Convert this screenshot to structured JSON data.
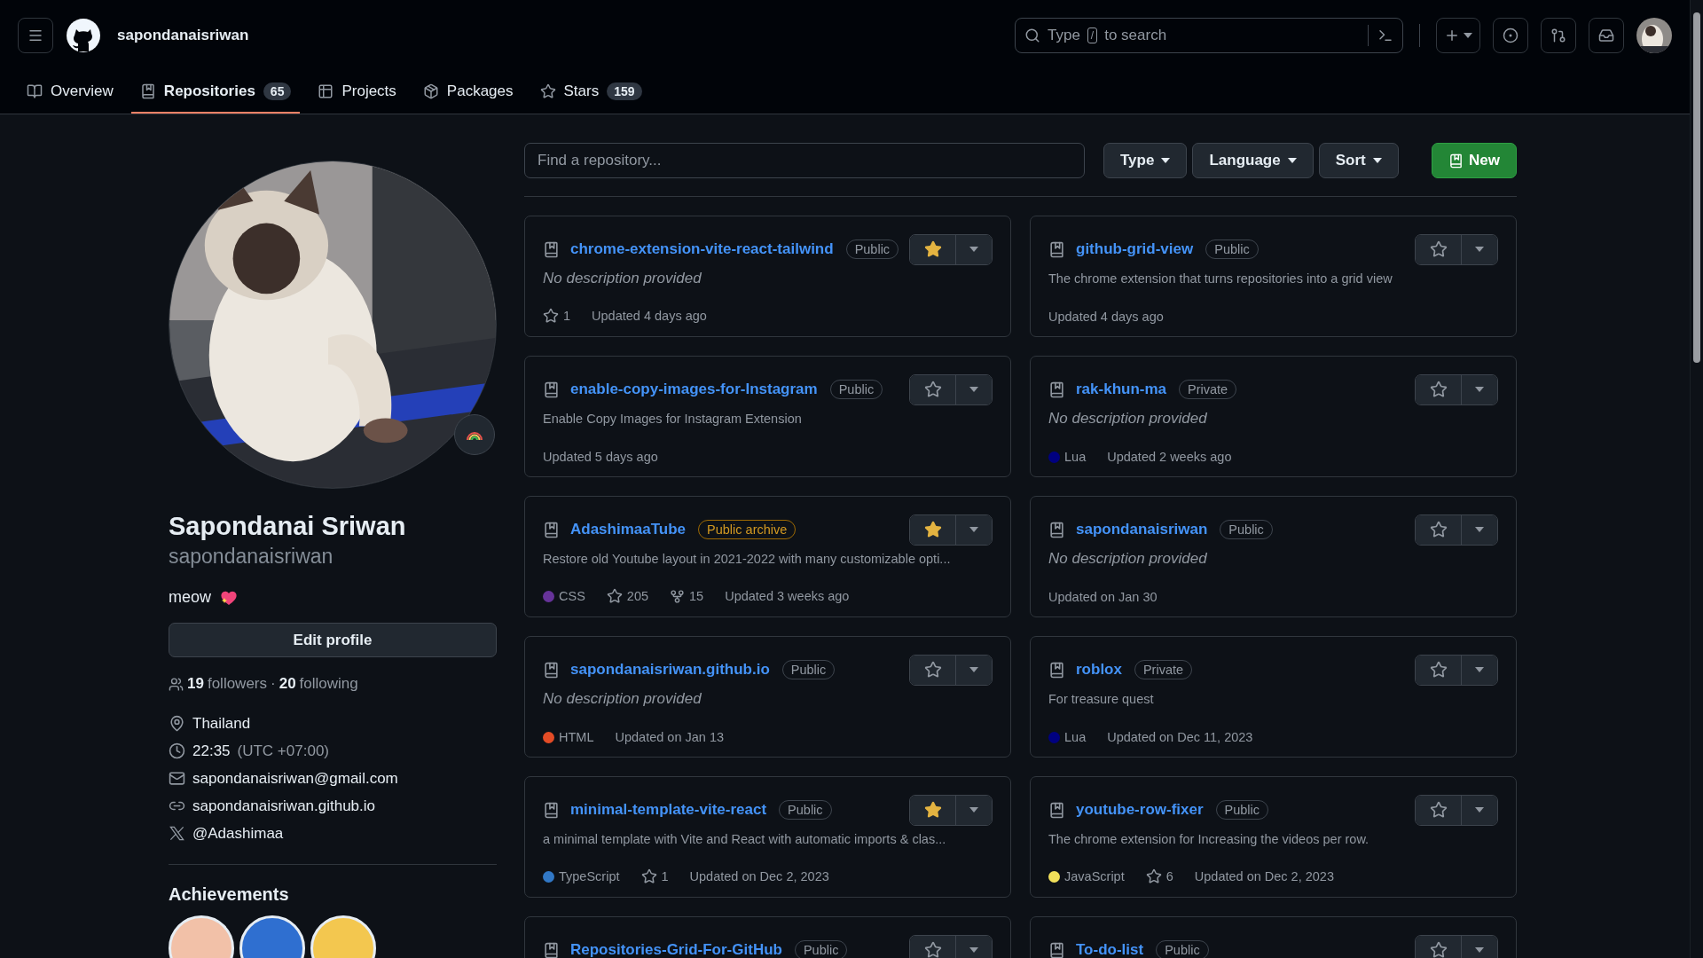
{
  "header": {
    "username": "sapondanaisriwan",
    "search": {
      "prefix": "Type",
      "key": "/",
      "suffix": "to search"
    }
  },
  "tabs": [
    {
      "label": "Overview",
      "kind": "book",
      "selected": false
    },
    {
      "label": "Repositories",
      "kind": "repo",
      "count": "65",
      "selected": true
    },
    {
      "label": "Projects",
      "kind": "table",
      "selected": false
    },
    {
      "label": "Packages",
      "kind": "package",
      "selected": false
    },
    {
      "label": "Stars",
      "kind": "star",
      "count": "159",
      "selected": false
    }
  ],
  "profile": {
    "name": "Sapondanai Sriwan",
    "login": "sapondanaisriwan",
    "bio": "meow",
    "edit_button": "Edit profile",
    "followers": "19",
    "followers_label": "followers",
    "separator": "·",
    "following": "20",
    "following_label": "following",
    "details": [
      {
        "kind": "location",
        "text": "Thailand"
      },
      {
        "kind": "time",
        "text": "22:35",
        "note": "(UTC +07:00)"
      },
      {
        "kind": "email",
        "text": "sapondanaisriwan@gmail.com"
      },
      {
        "kind": "link",
        "text": "sapondanaisriwan.github.io"
      },
      {
        "kind": "x",
        "text": "@Adashimaa"
      }
    ],
    "achievements_title": "Achievements",
    "achievements": [
      {
        "color": "#f2c1a8"
      },
      {
        "color": "#2f6fd0"
      },
      {
        "color": "#f3c74f"
      }
    ]
  },
  "filters": {
    "search_placeholder": "Find a repository...",
    "dropdowns": [
      "Type",
      "Language",
      "Sort"
    ],
    "new_button": "New"
  },
  "repos": [
    {
      "name": "chrome-extension-vite-react-tailwind",
      "visibility": "Public",
      "archived": false,
      "description": "No description provided",
      "empty_description": true,
      "stars": "1",
      "updated": "Updated 4 days ago",
      "starred": true
    },
    {
      "name": "github-grid-view",
      "visibility": "Public",
      "archived": false,
      "description": "The chrome extension that turns repositories into a grid view",
      "empty_description": false,
      "updated": "Updated 4 days ago",
      "starred": false
    },
    {
      "name": "enable-copy-images-for-Instagram",
      "visibility": "Public",
      "archived": false,
      "description": "Enable Copy Images for Instagram Extension",
      "empty_description": false,
      "updated": "Updated 5 days ago",
      "starred": false
    },
    {
      "name": "rak-khun-ma",
      "visibility": "Private",
      "archived": false,
      "description": "No description provided",
      "empty_description": true,
      "language": "Lua",
      "color": "#000080",
      "updated": "Updated 2 weeks ago",
      "starred": false
    },
    {
      "name": "AdashimaaTube",
      "visibility": "Public archive",
      "archived": true,
      "description": "Restore old Youtube layout in 2021-2022 with many customizable opti...",
      "empty_description": false,
      "language": "CSS",
      "color": "#663399",
      "stars": "205",
      "forks": "15",
      "updated": "Updated 3 weeks ago",
      "starred": true
    },
    {
      "name": "sapondanaisriwan",
      "visibility": "Public",
      "archived": false,
      "description": "No description provided",
      "empty_description": true,
      "updated": "Updated on Jan 30",
      "starred": false
    },
    {
      "name": "sapondanaisriwan.github.io",
      "visibility": "Public",
      "archived": false,
      "description": "No description provided",
      "empty_description": true,
      "language": "HTML",
      "color": "#e34c26",
      "updated": "Updated on Jan 13",
      "starred": false
    },
    {
      "name": "roblox",
      "visibility": "Private",
      "archived": false,
      "description": "For treasure quest",
      "empty_description": false,
      "language": "Lua",
      "color": "#000080",
      "updated": "Updated on Dec 11, 2023",
      "starred": false
    },
    {
      "name": "minimal-template-vite-react",
      "visibility": "Public",
      "archived": false,
      "description": "a minimal template with Vite and React with automatic imports & clas...",
      "empty_description": false,
      "language": "TypeScript",
      "color": "#3178c6",
      "stars": "1",
      "updated": "Updated on Dec 2, 2023",
      "starred": true
    },
    {
      "name": "youtube-row-fixer",
      "visibility": "Public",
      "archived": false,
      "description": "The chrome extension for Increasing the videos per row.",
      "empty_description": false,
      "language": "JavaScript",
      "color": "#f1e05a",
      "stars": "6",
      "updated": "Updated on Dec 2, 2023",
      "starred": false
    },
    {
      "name": "Repositories-Grid-For-GitHub",
      "visibility": "Public",
      "archived": false,
      "starred": false
    },
    {
      "name": "To-do-list",
      "visibility": "Public",
      "archived": false,
      "starred": false
    }
  ]
}
